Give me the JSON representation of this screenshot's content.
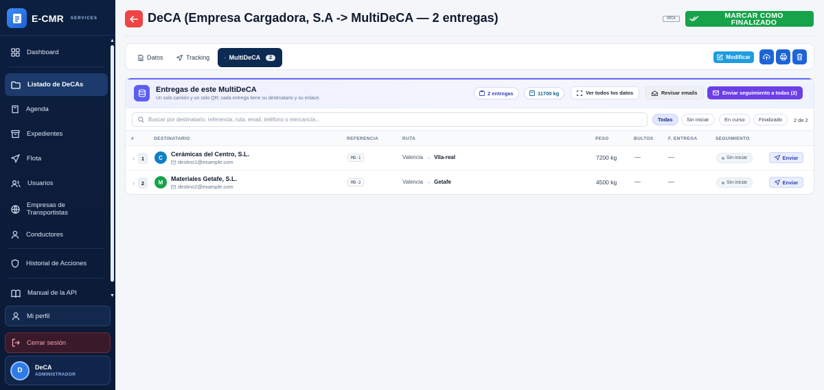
{
  "app": {
    "name": "E-CMR",
    "sub": "SERVICES"
  },
  "sidebar": {
    "items": [
      {
        "label": "Dashboard",
        "icon": "grid-icon"
      },
      {
        "label": "Listado de DeCAs",
        "icon": "folder-icon",
        "active": true
      },
      {
        "label": "Agenda",
        "icon": "book-icon"
      },
      {
        "label": "Expedientes",
        "icon": "archive-icon"
      },
      {
        "label": "Flota",
        "icon": "navigation-icon"
      },
      {
        "label": "Usuarios",
        "icon": "users-icon"
      },
      {
        "label": "Empresas de Transportistas",
        "icon": "globe-icon"
      },
      {
        "label": "Conductores",
        "icon": "user-icon"
      },
      {
        "label": "Historial de Acciones",
        "icon": "shield-icon"
      },
      {
        "label": "Manual de la API",
        "icon": "open-book-icon"
      }
    ],
    "profile": "Mi perfil",
    "logout": "Cerrar sesión",
    "user": {
      "initial": "D",
      "name": "DeCA",
      "role": "ADMINISTRADOR"
    }
  },
  "header": {
    "title": "DeCA (Empresa Cargadora, S.A -> MultiDeCA — 2 entregas)",
    "tag": "DECA",
    "finish_button": "MARCAR COMO FINALIZADO"
  },
  "tabs": [
    {
      "label": "Datos"
    },
    {
      "label": "Tracking"
    },
    {
      "label": "MultiDeCA",
      "badge": "2",
      "active": true
    }
  ],
  "actions": {
    "modify": "Modificar"
  },
  "panel": {
    "title": "Entregas de este MultiDeCA",
    "subtitle": "Un solo camión y un solo QR; cada entrega tiene su destinatario y su enlace.",
    "deliveries_pill": "2 entregas",
    "weight_pill": "11700 kg",
    "view_all": "Ver todos los datos",
    "review_emails": "Revisar emails",
    "send_all": "Enviar seguimiento a todas (2)",
    "search_placeholder": "Buscar por destinatario, referencia, ruta, email, teléfono o mercancía...",
    "filters": [
      "Todas",
      "Sin iniciar",
      "En curso",
      "Finalizado"
    ],
    "active_filter": "Todas",
    "count": "2 de 2",
    "columns": [
      "#",
      "DESTINATARIO",
      "REFERENCIA",
      "RUTA",
      "PESO",
      "BULTOS",
      "F. ENTREGA",
      "SEGUIMIENTO"
    ],
    "rows": [
      {
        "n": "1",
        "initial": "C",
        "color": "#0e7fc7",
        "name": "Cerámicas del Centro, S.L.",
        "email": "destino1@example.com",
        "ref": "MD-1",
        "from": "Valencia",
        "to": "Vila-real",
        "weight": "7200 kg",
        "bultos": "—",
        "fecha": "—",
        "status": "Sin iniciar",
        "action": "Enviar"
      },
      {
        "n": "2",
        "initial": "M",
        "color": "#16a34a",
        "name": "Materiales Getafe, S.L.",
        "email": "destino2@example.com",
        "ref": "MD-2",
        "from": "Valencia",
        "to": "Getafe",
        "weight": "4500 kg",
        "bultos": "—",
        "fecha": "—",
        "status": "Sin iniciar",
        "action": "Enviar"
      }
    ]
  },
  "colors": {
    "sidebar": "#0c1f3f",
    "accent": "#5b5ff0",
    "finish": "#16a34a",
    "back": "#ef4444",
    "primary": "#1d64d8"
  }
}
